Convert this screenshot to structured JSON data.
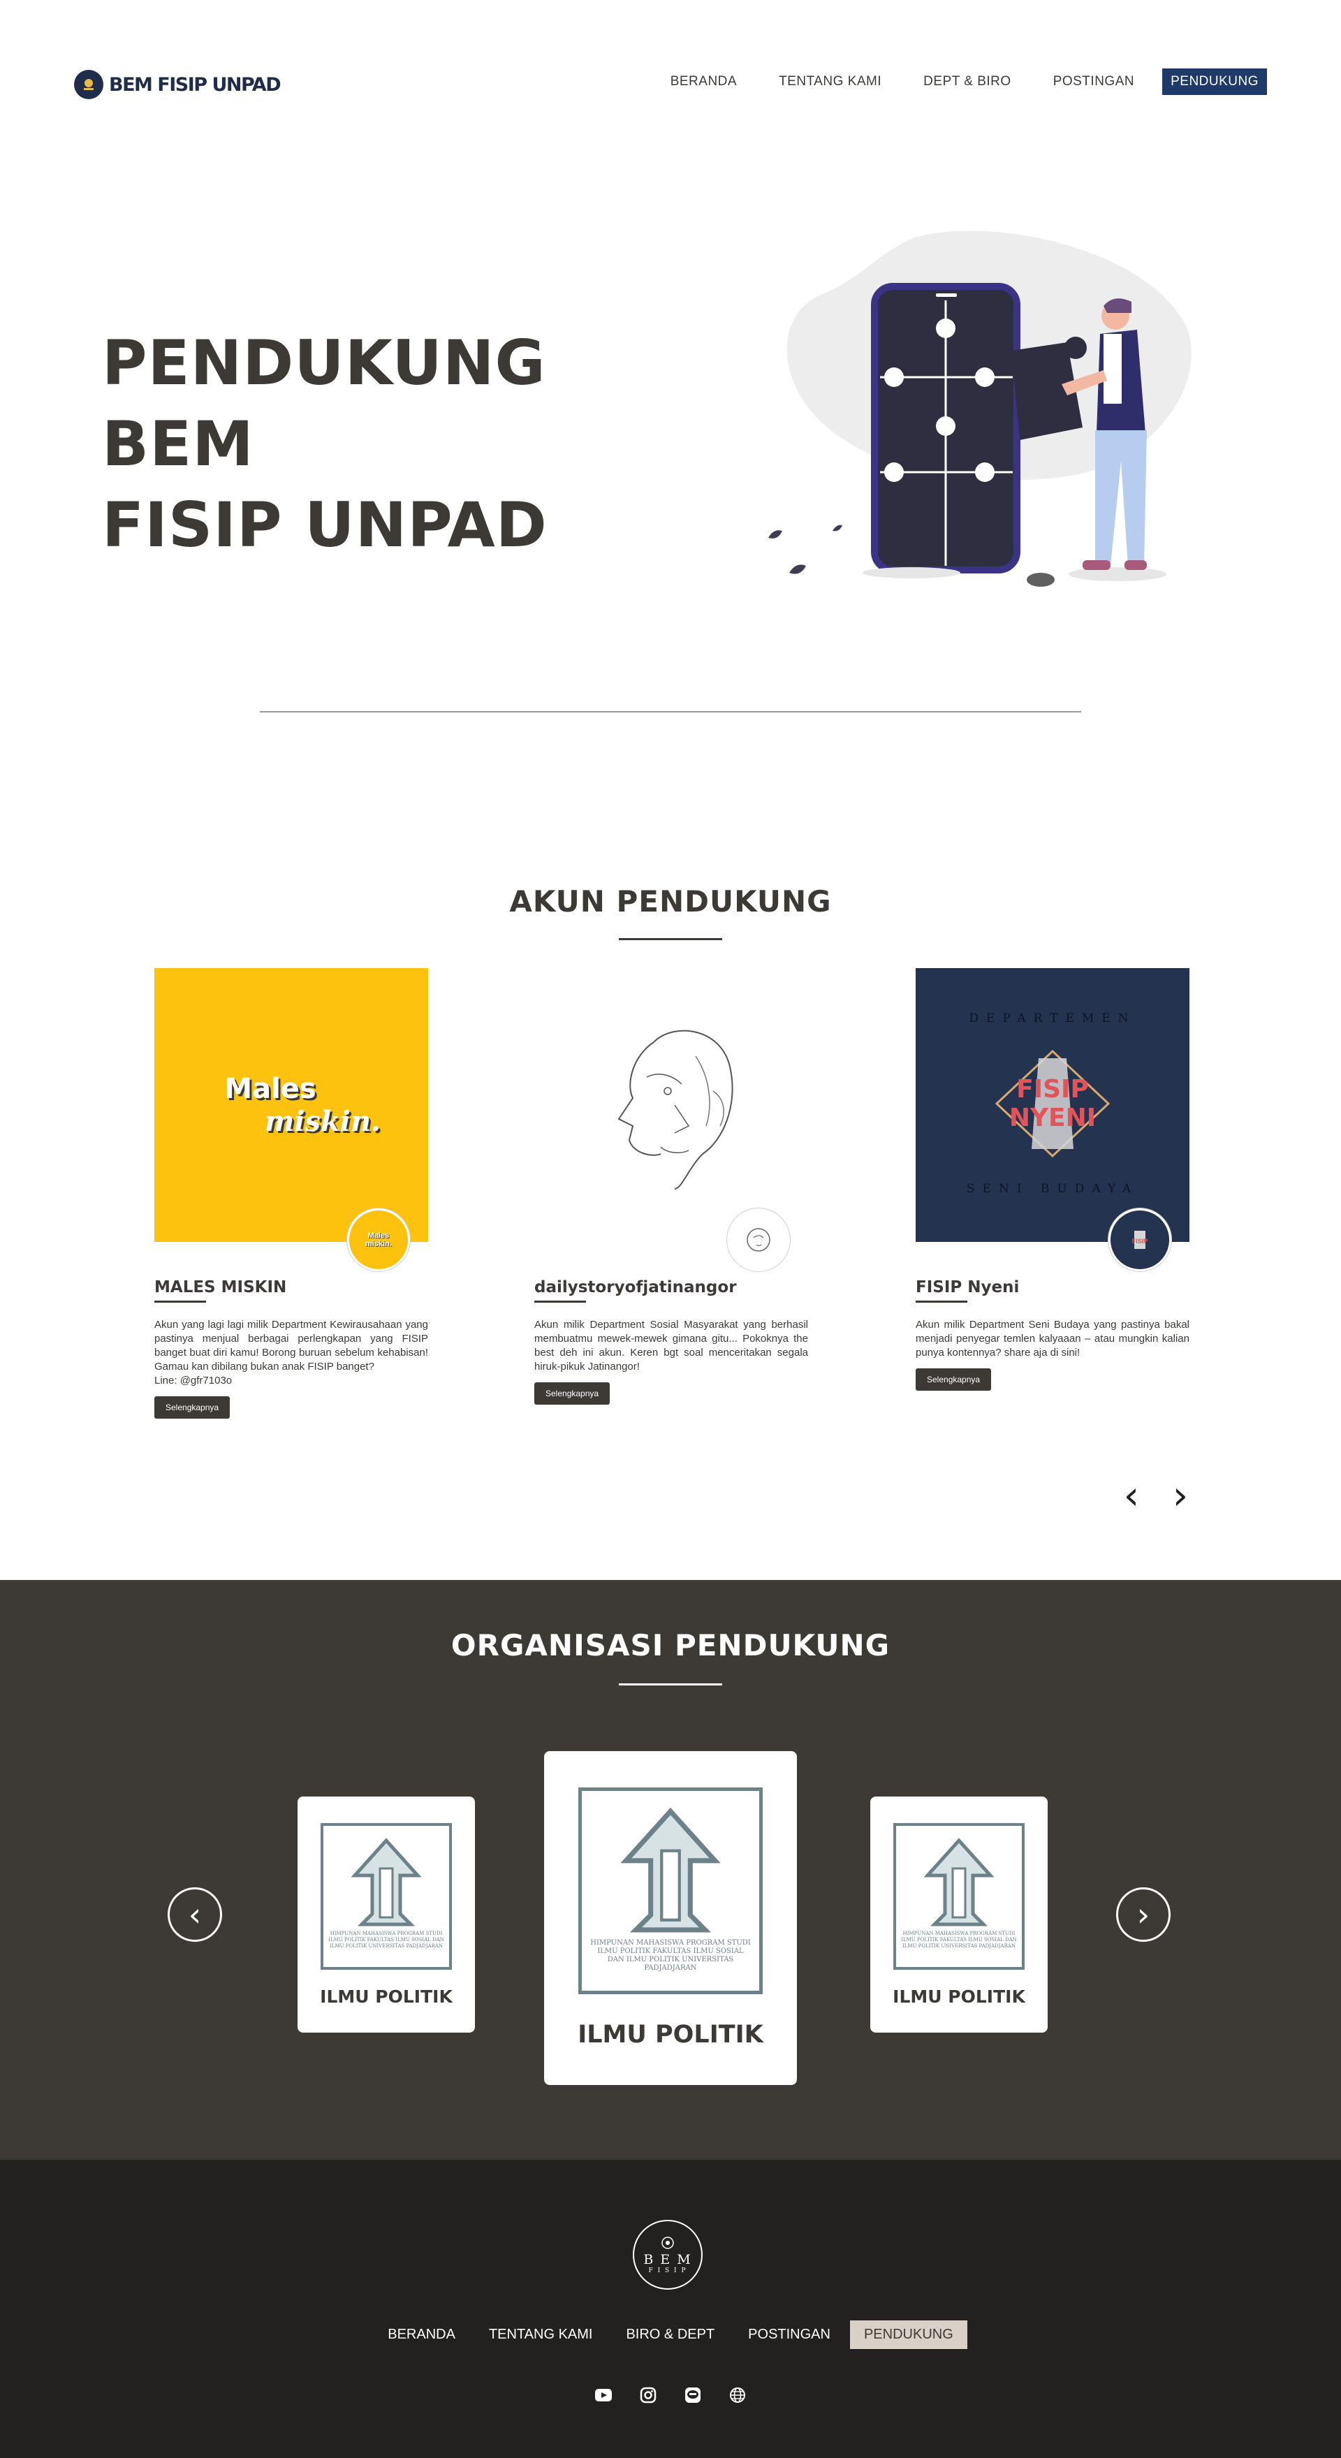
{
  "nav": {
    "brand": "BEM FISIP UNPAD",
    "links": [
      "BERANDA",
      "TENTANG KAMI",
      "DEPT & BIRO",
      "POSTINGAN",
      "PENDUKUNG"
    ]
  },
  "hero": {
    "title_line1": "PENDUKUNG BEM",
    "title_line2": "FISIP UNPAD"
  },
  "akun": {
    "title": "AKUN PENDUKUNG",
    "cards": [
      {
        "image_text1": "Males",
        "image_text2": "miskin.",
        "avatar_text": "Males miskin.",
        "name": "MALES MISKIN",
        "desc": "Akun yang lagi lagi milik Department Kewirausahaan yang pastinya menjual berbagai perlengkapan yang FISIP banget buat diri kamu! Borong buruan sebelum kehabisan! Gamau kan dibilang bukan anak FISIP banget?",
        "desc2": "Line: @gfr7103o",
        "button": "Selengkapnya"
      },
      {
        "name": "dailystoryofjatinangor",
        "desc": "Akun milik Department Sosial Masyarakat yang berhasil membuatmu mewek-mewek gimana gitu... Pokoknya the best deh ini akun. Keren bgt soal menceritakan segala hiruk-pikuk Jatinangor!",
        "button": "Selengkapnya"
      },
      {
        "image_top": "DEPARTEMEN",
        "image_mid1": "FISIP",
        "image_mid2": "NYENI",
        "image_bottom": "SENI BUDAYA",
        "name": "FISIP Nyeni",
        "desc": "Akun milik Department Seni Budaya yang pastinya bakal menjadi penyegar temlen kalyaaan – atau mungkin kalian punya kontennya? share aja di sini!",
        "button": "Selengkapnya"
      }
    ],
    "prev": "‹",
    "next": "›"
  },
  "org": {
    "title": "ORGANISASI PENDUKUNG",
    "logo_caption": "HIMPUNAN MAHASISWA PROGRAM STUDI ILMU POLITIK FAKULTAS ILMU SOSIAL DAN ILMU POLITIK UNIVERSITAS PADJADJARAN",
    "cards": [
      {
        "label": "ILMU POLITIK"
      },
      {
        "label": "ILMU POLITIK"
      },
      {
        "label": "ILMU POLITIK"
      }
    ]
  },
  "footer": {
    "logo_main": "B E M",
    "logo_sub": "F I S I P",
    "links": [
      "BERANDA",
      "TENTANG KAMI",
      "BIRO & DEPT",
      "POSTINGAN",
      "PENDUKUNG"
    ],
    "icons": [
      "youtube-icon",
      "instagram-icon",
      "line-icon",
      "web-icon"
    ]
  },
  "colors": {
    "navy": "#1f3a68",
    "dark": "#3d3a36",
    "footer": "#232120",
    "yellow": "#fdc20e",
    "card_navy": "#243450"
  }
}
